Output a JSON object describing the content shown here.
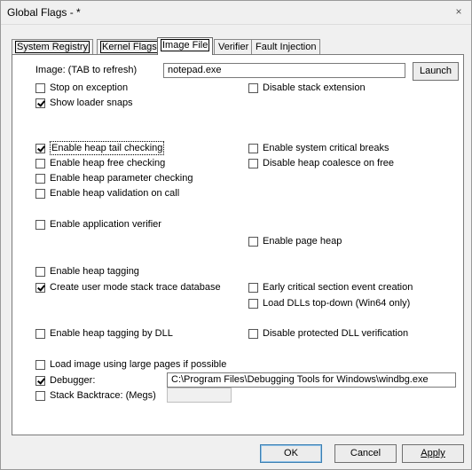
{
  "window": {
    "title": "Global Flags - *",
    "close_glyph": "×"
  },
  "tabs": [
    {
      "label": "System Registry"
    },
    {
      "label": "Kernel Flags"
    },
    {
      "label": "Image File"
    },
    {
      "label": "Verifier"
    },
    {
      "label": "Fault Injection"
    }
  ],
  "image": {
    "label": "Image: (TAB to refresh)",
    "value": "notepad.exe",
    "launch_label": "Launch"
  },
  "flags": {
    "stop_on_exception": {
      "label": "Stop on exception",
      "checked": false
    },
    "show_loader_snaps": {
      "label": "Show loader snaps",
      "checked": true
    },
    "disable_stack_extension": {
      "label": "Disable stack extension",
      "checked": false
    },
    "heap_tail_checking": {
      "label": "Enable heap tail checking",
      "checked": true
    },
    "heap_free_checking": {
      "label": "Enable heap free checking",
      "checked": false
    },
    "heap_parameter_checking": {
      "label": "Enable heap parameter checking",
      "checked": false
    },
    "heap_validation_on_call": {
      "label": "Enable heap validation on call",
      "checked": false
    },
    "system_critical_breaks": {
      "label": "Enable system critical breaks",
      "checked": false
    },
    "disable_heap_coalesce": {
      "label": "Disable heap coalesce on free",
      "checked": false
    },
    "application_verifier": {
      "label": "Enable application verifier",
      "checked": false
    },
    "page_heap": {
      "label": "Enable page heap",
      "checked": false
    },
    "heap_tagging": {
      "label": "Enable heap tagging",
      "checked": false
    },
    "user_mode_stack_trace": {
      "label": "Create user mode stack trace database",
      "checked": true
    },
    "early_critical_section": {
      "label": "Early critical section event creation",
      "checked": false
    },
    "load_dlls_top_down": {
      "label": "Load DLLs top-down (Win64 only)",
      "checked": false
    },
    "heap_tagging_by_dll": {
      "label": "Enable heap tagging by DLL",
      "checked": false
    },
    "disable_protected_dll": {
      "label": "Disable protected DLL verification",
      "checked": false
    },
    "large_pages": {
      "label": "Load image using large pages if possible",
      "checked": false
    },
    "debugger": {
      "label": "Debugger:",
      "checked": true
    },
    "stack_backtrace": {
      "label": "Stack Backtrace: (Megs)",
      "checked": false
    }
  },
  "debugger_path": "C:\\Program Files\\Debugging Tools for Windows\\windbg.exe",
  "stack_backtrace_value": "",
  "buttons": {
    "ok": "OK",
    "cancel": "Cancel",
    "apply": "Apply"
  }
}
